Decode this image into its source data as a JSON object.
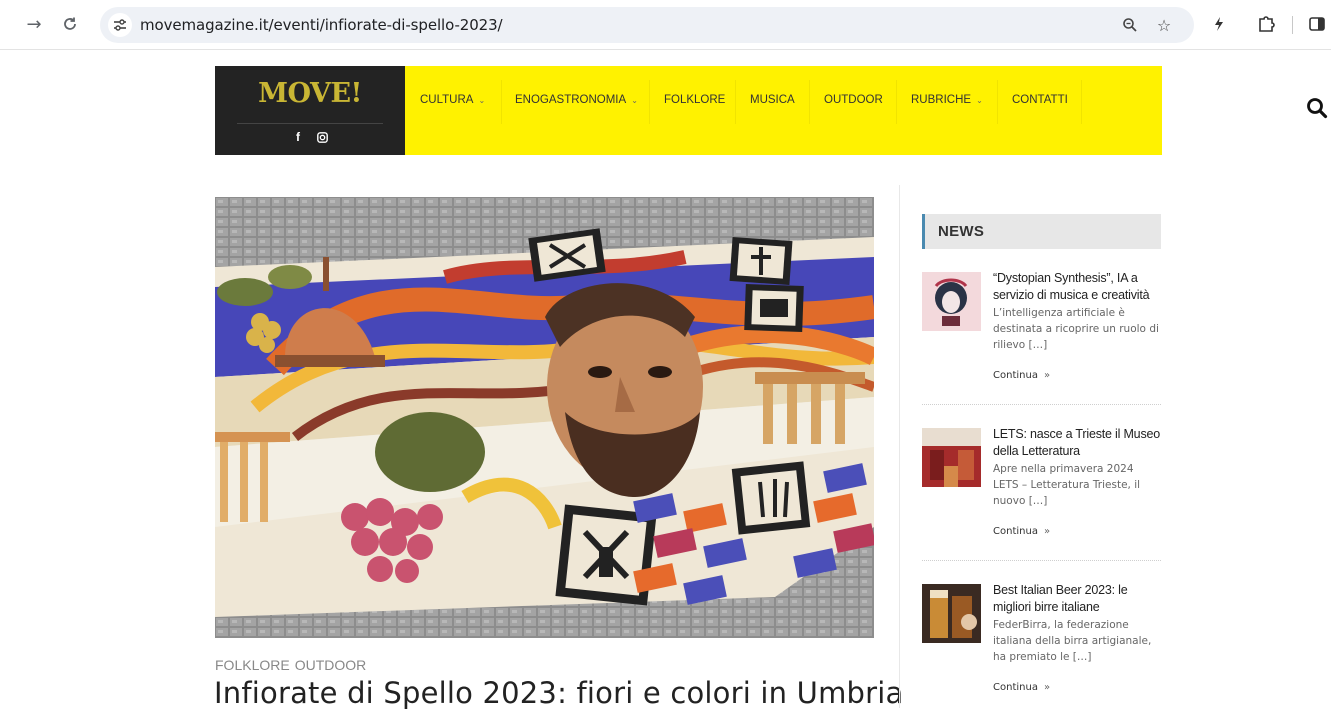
{
  "browser": {
    "url": "movemagazine.it/eventi/infiorate-di-spello-2023/"
  },
  "site": {
    "logo": "MOVE!",
    "social": [
      "f",
      "◎"
    ],
    "menu": [
      {
        "label": "CULTURA",
        "has_dropdown": true
      },
      {
        "label": "ENOGASTRONOMIA",
        "has_dropdown": true
      },
      {
        "label": "FOLKLORE",
        "has_dropdown": false
      },
      {
        "label": "MUSICA",
        "has_dropdown": false
      },
      {
        "label": "OUTDOOR",
        "has_dropdown": false
      },
      {
        "label": "RUBRICHE",
        "has_dropdown": true
      },
      {
        "label": "CONTATTI",
        "has_dropdown": false
      }
    ],
    "menu_chevron": "⌄",
    "colors": {
      "menu_bg": "#fff200",
      "logo_bg": "#232323",
      "logo_text": "#c9b634",
      "news_accent": "#4a8ab0"
    }
  },
  "post": {
    "categories": [
      "FOLKLORE",
      "OUTDOOR"
    ],
    "title": "Infiorate di Spello 2023: fiori e colori in Umbria"
  },
  "sidebar": {
    "heading": "NEWS",
    "items": [
      {
        "title": "“Dystopian Synthesis”, IA a servizio di musica e creatività",
        "excerpt": "L’intelligenza artificiale è destinata a ricoprire un ruolo di rilievo […]",
        "more": "Continua",
        "more_icon": "»"
      },
      {
        "title": "LETS: nasce a Trieste il Museo della Letteratura",
        "excerpt": "Apre nella primavera 2024 LETS – Letteratura Trieste, il nuovo […]",
        "more": "Continua",
        "more_icon": "»"
      },
      {
        "title": "Best Italian Beer 2023: le migliori birre italiane",
        "excerpt": "FederBirra, la federazione italiana della birra artigianale, ha premiato le […]",
        "more": "Continua",
        "more_icon": "»"
      }
    ]
  }
}
